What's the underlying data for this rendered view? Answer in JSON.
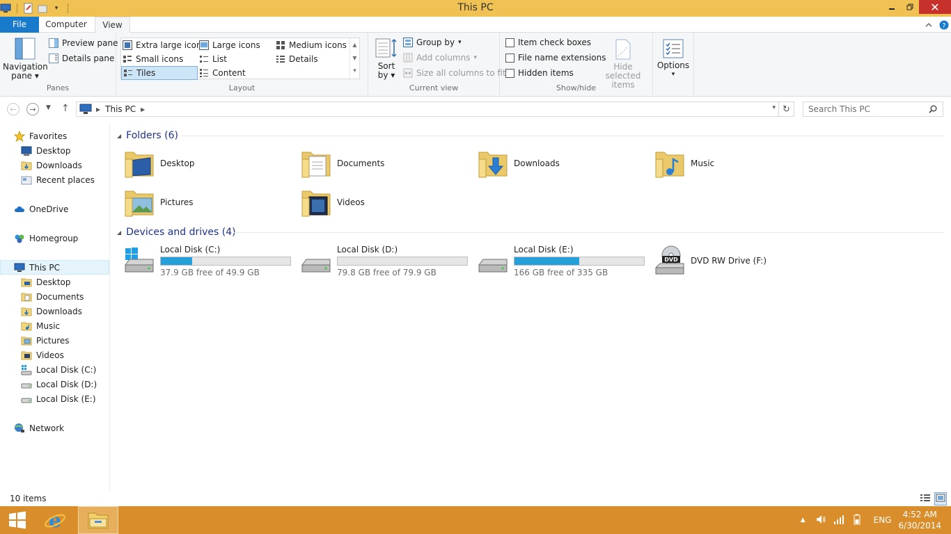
{
  "window": {
    "title": "This PC"
  },
  "ribbon_tabs": {
    "file": "File",
    "computer": "Computer",
    "view": "View"
  },
  "panes": {
    "navigation_pane": "Navigation pane",
    "preview_pane": "Preview pane",
    "details_pane": "Details pane",
    "label": "Panes"
  },
  "layout": {
    "extra_large_icons": "Extra large icons",
    "large_icons": "Large icons",
    "medium_icons": "Medium icons",
    "small_icons": "Small icons",
    "list": "List",
    "details": "Details",
    "tiles": "Tiles",
    "content": "Content",
    "label": "Layout",
    "selected": "Tiles"
  },
  "current_view": {
    "sort_by": "Sort by",
    "group_by": "Group by",
    "add_columns": "Add columns",
    "size_all_columns": "Size all columns to fit",
    "label": "Current view"
  },
  "show_hide": {
    "item_check_boxes": "Item check boxes",
    "file_name_extensions": "File name extensions",
    "hidden_items": "Hidden items",
    "hide_selected_items": "Hide selected items",
    "label": "Show/hide"
  },
  "options": {
    "label": "Options"
  },
  "address": {
    "path": "This PC",
    "search_placeholder": "Search This PC"
  },
  "nav": {
    "favorites": "Favorites",
    "fav_items": [
      "Desktop",
      "Downloads",
      "Recent places"
    ],
    "onedrive": "OneDrive",
    "homegroup": "Homegroup",
    "this_pc": "This PC",
    "pc_items": [
      "Desktop",
      "Documents",
      "Downloads",
      "Music",
      "Pictures",
      "Videos",
      "Local Disk (C:)",
      "Local Disk (D:)",
      "Local Disk (E:)"
    ],
    "network": "Network"
  },
  "folders": {
    "header": "Folders (6)",
    "items": [
      "Desktop",
      "Documents",
      "Downloads",
      "Music",
      "Pictures",
      "Videos"
    ]
  },
  "drives": {
    "header": "Devices and drives (4)",
    "items": [
      {
        "name": "Local Disk (C:)",
        "free": "37.9 GB free of 49.9 GB",
        "used_fraction": 0.24
      },
      {
        "name": "Local Disk (D:)",
        "free": "79.8 GB free of 79.9 GB",
        "used_fraction": 0.0
      },
      {
        "name": "Local Disk (E:)",
        "free": "166 GB free of 335 GB",
        "used_fraction": 0.5
      },
      {
        "name": "DVD RW Drive (F:)"
      }
    ],
    "dvd_badge": "DVD"
  },
  "status": {
    "count": "10 items"
  },
  "taskbar": {
    "language": "ENG",
    "time": "4:52 AM",
    "date": "6/30/2014"
  },
  "colors": {
    "accent": "#1979ca",
    "title": "#f0c254",
    "taskbar": "#d98e2b",
    "bar_fill": "#26a0da"
  }
}
